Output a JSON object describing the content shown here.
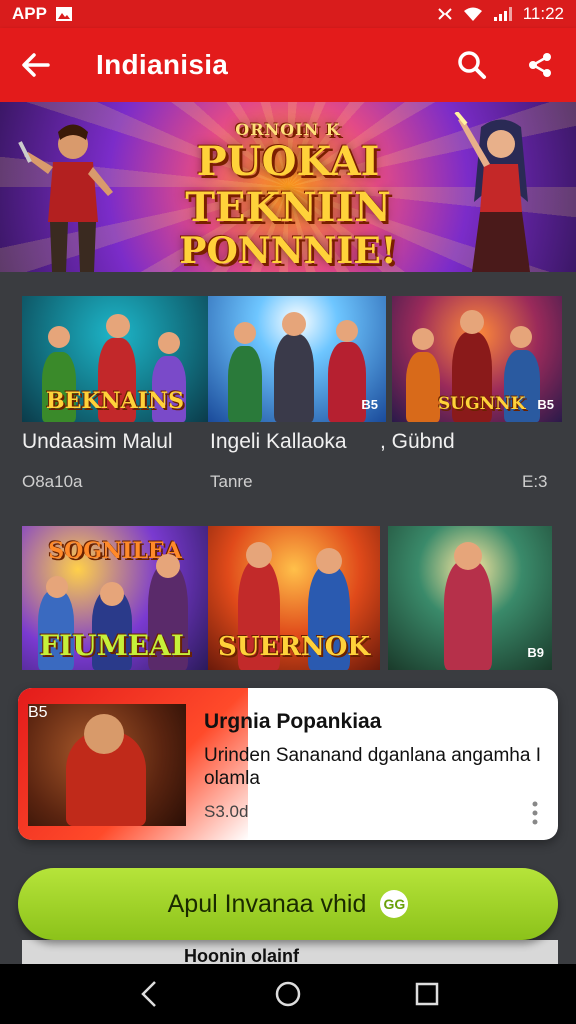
{
  "status_bar": {
    "left_text": "APP",
    "time": "11:22",
    "icons": [
      "image-icon",
      "nfc-icon",
      "wifi-icon",
      "signal-icon",
      "battery-icon"
    ]
  },
  "app_bar": {
    "title": "Indianisia",
    "back_icon": "arrow-left-icon",
    "search_icon": "search-icon",
    "share_icon": "share-icon",
    "color": "#e31b1b"
  },
  "hero": {
    "subtitle": "ORNOIN K",
    "line1": "PUOKAI TEKNIIN",
    "line2": "PONNNIE!"
  },
  "row1": {
    "tiles": [
      {
        "label": "BEKNAINS",
        "badge": ""
      },
      {
        "label": "",
        "badge": "B5"
      },
      {
        "label": "SUGNNK",
        "badge": "B5"
      }
    ],
    "captions": [
      {
        "title": "Undaasim Malul",
        "sub": "O8a10a"
      },
      {
        "title": "Ingeli Kallaoka",
        "sub": "Tanre"
      },
      {
        "title": ", Gübnd",
        "sub": "E:3"
      }
    ]
  },
  "row2": {
    "tiles": [
      {
        "label": "FIUMEAL",
        "top_label": "SOGNILEA",
        "badge": ""
      },
      {
        "label": "SUERNOK",
        "badge": ""
      },
      {
        "label": "",
        "badge": "B9"
      }
    ]
  },
  "featured": {
    "title": "Urgnia Popankiaa",
    "description": "Urinden Sananand dganlana angamha I olamla",
    "price": "S3.0d",
    "thumb_badge": "B5"
  },
  "cta": {
    "label": "Apul Invanaa vhid",
    "icon": "GG",
    "color": "#9ad22a"
  },
  "peek": {
    "text": "Hoonin olainf"
  },
  "nav": {
    "back_icon": "nav-back-icon",
    "home_icon": "nav-home-icon",
    "recents_icon": "nav-recents-icon"
  }
}
